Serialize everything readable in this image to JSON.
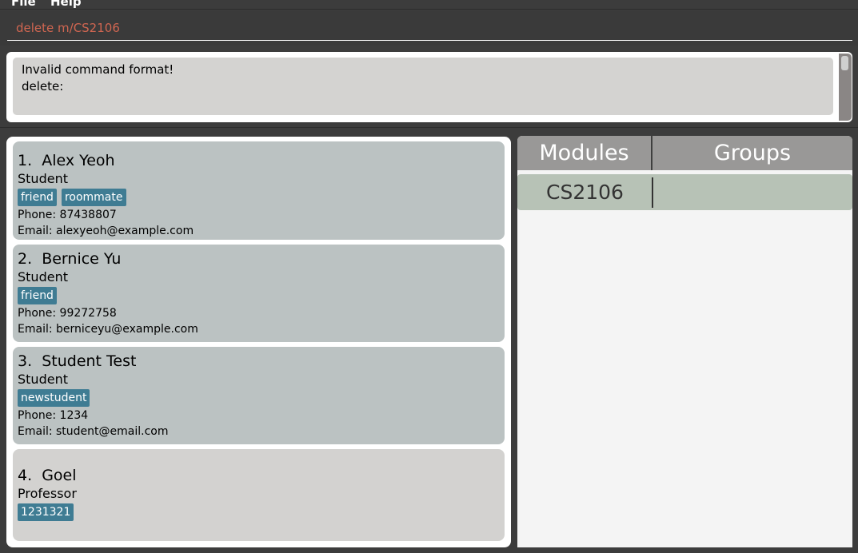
{
  "menu": {
    "file_label": "File",
    "help_label": "Help"
  },
  "command": {
    "value": "delete m/CS2106"
  },
  "result": {
    "lines": [
      "Invalid command format!",
      "delete:"
    ]
  },
  "persons": [
    {
      "name": "1.  Alex Yeoh",
      "role": "Student",
      "tags": [
        "friend",
        "roommate"
      ],
      "phone": "Phone: 87438807",
      "email": "Email: alexyeoh@example.com"
    },
    {
      "name": "2.  Bernice Yu",
      "role": "Student",
      "tags": [
        "friend"
      ],
      "phone": "Phone: 99272758",
      "email": "Email: berniceyu@example.com"
    },
    {
      "name": "3.  Student Test",
      "role": "Student",
      "tags": [
        "newstudent"
      ],
      "phone": "Phone: 1234",
      "email": "Email: student@email.com"
    },
    {
      "name": "4.  Goel",
      "role": "Professor",
      "tags": [
        "1231321"
      ]
    }
  ],
  "module_table": {
    "headers": [
      "Modules",
      "Groups"
    ],
    "rows": [
      {
        "module": "CS2106",
        "groups": ""
      }
    ]
  },
  "colors": {
    "command_text": "#d06651",
    "tag_background": "#3f7c93",
    "card_background": "#bbc2c2",
    "selected_row": "#b7c2b6"
  }
}
